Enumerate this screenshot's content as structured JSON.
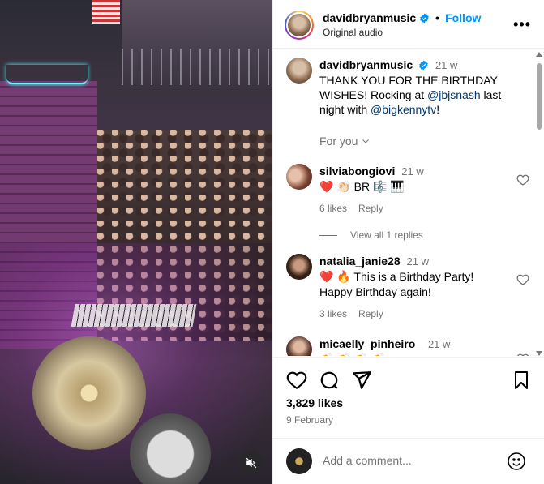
{
  "post": {
    "username": "davidbryanmusic",
    "follow_label": "Follow",
    "dot": "•",
    "audio": "Original audio",
    "more": "•••"
  },
  "caption": {
    "username": "davidbryanmusic",
    "time": "21 w",
    "text_1": "THANK YOU FOR THE BIRTHDAY WISHES! Rocking at ",
    "mention_1": "@jbjsnash",
    "text_2": " last night with ",
    "mention_2": "@bigkennytv",
    "text_3": "!"
  },
  "for_you": "For you",
  "comments": [
    {
      "username": "silviabongiovi",
      "time": "21 w",
      "text": "❤️ 👏🏻 BR 🎼 🎹",
      "likes": "6 likes",
      "reply": "Reply"
    },
    {
      "username": "natalia_janie28",
      "time": "21 w",
      "text": "❤️ 🔥 This is a Birthday Party! Happy Birthday again!",
      "likes": "3 likes",
      "reply": "Reply"
    },
    {
      "username": "micaelly_pinheiro_",
      "time": "21 w",
      "text": "👏 👏 👏 👏"
    }
  ],
  "view_all_replies": "View all 1 replies",
  "likes_count": "3,829 likes",
  "date": "9 February",
  "add_comment_placeholder": "Add a comment...",
  "colors": {
    "accent": "#0095f6",
    "mention": "#00376b",
    "muted": "#737373",
    "heart_red": "#ed4956"
  },
  "icons": [
    "verified-badge-icon",
    "more-options-icon",
    "chevron-down-icon",
    "heart-icon",
    "comment-icon",
    "share-icon",
    "bookmark-icon",
    "emoji-icon",
    "muted-audio-icon"
  ]
}
